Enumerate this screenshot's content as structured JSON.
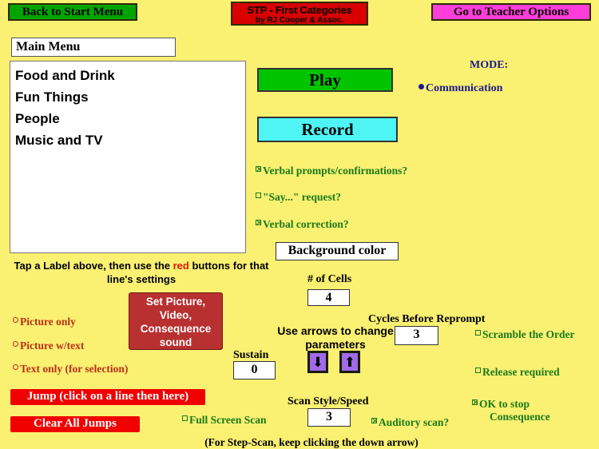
{
  "app": {
    "background_color": "#FAF072",
    "title_line1": "STP - First Categories",
    "title_line2": "by RJ Cooper & Assoc."
  },
  "header": {
    "back_button": "Back to Start Menu",
    "teacher_options_button": "Go to Teacher Options"
  },
  "menu": {
    "name_value": "Main Menu",
    "items": [
      "Food and Drink",
      "Fun Things",
      "People",
      "Music and TV"
    ]
  },
  "actions": {
    "play_label": "Play",
    "record_label": "Record",
    "background_color_label": "Background color",
    "set_picture_label": "Set Picture, Video, Consequence sound",
    "jump_label": "Jump (click on a line then here)",
    "clear_all_jumps_label": "Clear All Jumps"
  },
  "mode": {
    "title": "MODE:",
    "selected": "Communication"
  },
  "speech_options": [
    {
      "label": "Verbal prompts/confirmations?",
      "checked": true
    },
    {
      "label": "\"Say...\" request?",
      "checked": false
    },
    {
      "label": "Verbal correction?",
      "checked": true
    }
  ],
  "display_options": [
    {
      "label": "Picture only",
      "checked": false
    },
    {
      "label": "Picture w/text",
      "checked": false
    },
    {
      "label": "Text only (for selection)",
      "checked": false
    }
  ],
  "scan_options": [
    {
      "label": "Scramble the Order",
      "checked": false
    },
    {
      "label": "Release required",
      "checked": false
    },
    {
      "label": "OK to stop",
      "label2": "Consequence",
      "checked": true
    }
  ],
  "instructions": {
    "tap_prefix": "Tap a Label above, then use the ",
    "tap_highlight": "red",
    "tap_suffix": " buttons for that line's settings",
    "use_arrows": "Use arrows to change parameters",
    "step_scan_note": "(For Step-Scan, keep clicking the down arrow)"
  },
  "parameters": {
    "cells_label": "# of Cells",
    "cells_value": "4",
    "cycles_label": "Cycles Before Reprompt",
    "cycles_value": "3",
    "sustain_label": "Sustain",
    "sustain_value": "0",
    "scan_label": "Scan Style/Speed",
    "scan_value": "3"
  },
  "bottom_options": {
    "full_screen_scan": "Full Screen Scan",
    "full_screen_scan_checked": false,
    "auditory_scan": "Auditory scan?",
    "auditory_scan_checked": true
  },
  "icons": {
    "arrow_down": "⬇",
    "arrow_up": "⬆"
  }
}
